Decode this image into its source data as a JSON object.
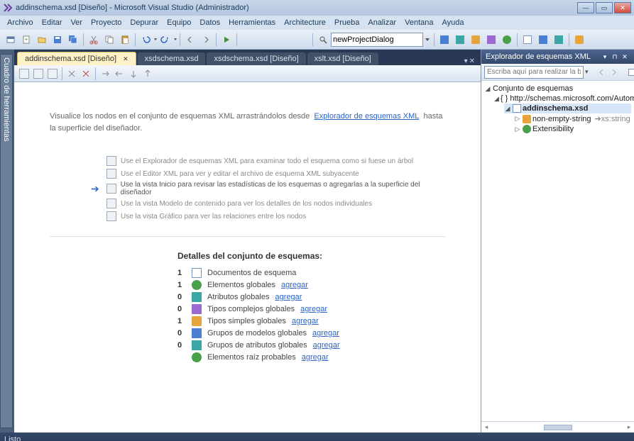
{
  "window": {
    "title": "addinschema.xsd [Diseño] - Microsoft Visual Studio (Administrador)"
  },
  "menu": [
    "Archivo",
    "Editar",
    "Ver",
    "Proyecto",
    "Depurar",
    "Equipo",
    "Datos",
    "Herramientas",
    "Architecture",
    "Prueba",
    "Analizar",
    "Ventana",
    "Ayuda"
  ],
  "toolbar_combo": "newProjectDialog",
  "tabs": [
    {
      "label": "addinschema.xsd [Diseño]",
      "active": true,
      "closable": true
    },
    {
      "label": "xsdschema.xsd",
      "active": false,
      "closable": false
    },
    {
      "label": "xsdschema.xsd [Diseño]",
      "active": false,
      "closable": false
    },
    {
      "label": "xslt.xsd [Diseño]",
      "active": false,
      "closable": false
    }
  ],
  "left_dock": {
    "label": "Cuadro de herramientas"
  },
  "designer": {
    "intro_prefix": "Visualice los nodos en el conjunto de esquemas XML arrastrándolos desde",
    "intro_link": "Explorador de esquemas XML",
    "intro_suffix": "hasta la superficie del diseñador.",
    "views": [
      {
        "label": "Use el Explorador de esquemas XML para examinar todo el esquema como si fuese un árbol",
        "current": false
      },
      {
        "label": "Use el Editor XML para ver y editar el archivo de esquema XML subyacente",
        "current": false
      },
      {
        "label": "Use la vista Inicio para revisar las estadísticas de los esquemas o agregarlas a la superficie del diseñador",
        "current": true
      },
      {
        "label": "Use la vista Modelo de contenido para ver los detalles de los nodos individuales",
        "current": false
      },
      {
        "label": "Use la vista Gráfico para ver las relaciones entre los nodos",
        "current": false
      }
    ],
    "details_heading": "Detalles del conjunto de esquemas:",
    "details": [
      {
        "count": "1",
        "icon": "doc",
        "label": "Documentos de esquema",
        "link": ""
      },
      {
        "count": "1",
        "icon": "green",
        "label": "Elementos globales",
        "link": "agregar"
      },
      {
        "count": "0",
        "icon": "teal",
        "label": "Atributos globales",
        "link": "agregar"
      },
      {
        "count": "0",
        "icon": "purple",
        "label": "Tipos complejos globales",
        "link": "agregar"
      },
      {
        "count": "1",
        "icon": "orange",
        "label": "Tipos simples globales",
        "link": "agregar"
      },
      {
        "count": "0",
        "icon": "blue",
        "label": "Grupos de modelos globales",
        "link": "agregar"
      },
      {
        "count": "0",
        "icon": "teal",
        "label": "Grupos de atributos globales",
        "link": "agregar"
      },
      {
        "count": "",
        "icon": "green",
        "label": "Elementos raíz probables",
        "link": "agregar"
      }
    ]
  },
  "explorer": {
    "title": "Explorador de esquemas XML",
    "search_placeholder": "Escriba aquí para realizar la b…",
    "root": "Conjunto de esquemas",
    "ns": "{ } http://schemas.microsoft.com/AutomationExtensibility",
    "file": "addinschema.xsd",
    "simpletype": "non-empty-string",
    "simpletype_base": "xs:string",
    "element": "Extensibility"
  },
  "status": "Listo"
}
